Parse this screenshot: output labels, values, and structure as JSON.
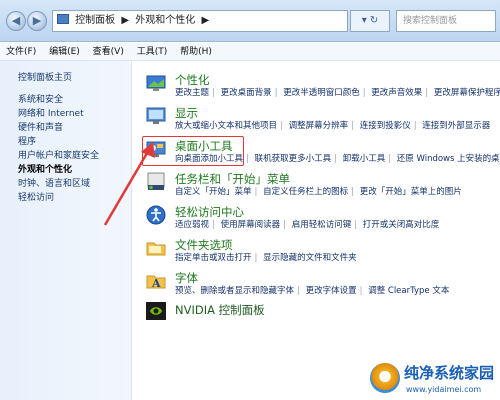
{
  "nav": {
    "back": "◀",
    "forward": "▶"
  },
  "address": {
    "path_items": [
      "控制面板",
      "▶",
      "外观和个性化",
      "▶"
    ]
  },
  "refresh": {
    "label": "▾ ↻"
  },
  "search": {
    "placeholder": "搜索控制面板"
  },
  "menu": {
    "items": [
      "文件(F)",
      "编辑(E)",
      "查看(V)",
      "工具(T)",
      "帮助(H)"
    ]
  },
  "sidebar": {
    "items": [
      "控制面板主页",
      "系统和安全",
      "网络和 Internet",
      "硬件和声音",
      "程序",
      "用户帐户和家庭安全",
      "外观和个性化",
      "时钟、语言和区域",
      "轻松访问"
    ],
    "active_index": 6
  },
  "categories": [
    {
      "title": "个性化",
      "icon": "personalization-icon",
      "links": [
        "更改主题",
        "更改桌面背景",
        "更改半透明窗口颜色",
        "更改声音效果",
        "更改屏幕保护程序"
      ]
    },
    {
      "title": "显示",
      "icon": "display-icon",
      "links": [
        "放大或缩小文本和其他项目",
        "调整屏幕分辨率",
        "连接到投影仪",
        "连接到外部显示器"
      ]
    },
    {
      "title": "桌面小工具",
      "icon": "gadgets-icon",
      "links": [
        "向桌面添加小工具",
        "联机获取更多小工具",
        "卸载小工具",
        "还原 Windows 上安装的桌面小"
      ]
    },
    {
      "title": "任务栏和「开始」菜单",
      "icon": "taskbar-icon",
      "links": [
        "自定义「开始」菜单",
        "自定义任务栏上的图标",
        "更改「开始」菜单上的图片"
      ]
    },
    {
      "title": "轻松访问中心",
      "icon": "ease-of-access-icon",
      "links": [
        "适应弱视",
        "使用屏幕阅读器",
        "启用轻松访问键",
        "打开或关闭高对比度"
      ]
    },
    {
      "title": "文件夹选项",
      "icon": "folder-options-icon",
      "links": [
        "指定单击或双击打开",
        "显示隐藏的文件和文件夹"
      ]
    },
    {
      "title": "字体",
      "icon": "fonts-icon",
      "links": [
        "预览、删除或者显示和隐藏字体",
        "更改字体设置",
        "调整 ClearType 文本"
      ]
    },
    {
      "title": "NVIDIA 控制面板",
      "icon": "nvidia-icon",
      "links": []
    }
  ],
  "watermark": {
    "title": "纯净系统家园",
    "url": "www.yidaimei.com"
  },
  "colors": {
    "category_title": "#1f7a1f",
    "link": "#14316b",
    "highlight": "#e03a3a"
  }
}
